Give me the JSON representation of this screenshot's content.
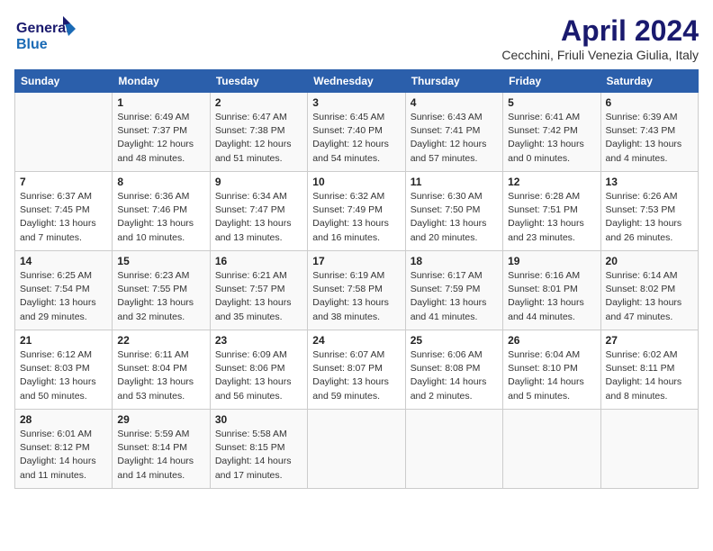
{
  "header": {
    "logo_line1": "General",
    "logo_line2": "Blue",
    "month_title": "April 2024",
    "location": "Cecchini, Friuli Venezia Giulia, Italy"
  },
  "columns": [
    "Sunday",
    "Monday",
    "Tuesday",
    "Wednesday",
    "Thursday",
    "Friday",
    "Saturday"
  ],
  "weeks": [
    [
      {
        "day": "",
        "info": ""
      },
      {
        "day": "1",
        "info": "Sunrise: 6:49 AM\nSunset: 7:37 PM\nDaylight: 12 hours\nand 48 minutes."
      },
      {
        "day": "2",
        "info": "Sunrise: 6:47 AM\nSunset: 7:38 PM\nDaylight: 12 hours\nand 51 minutes."
      },
      {
        "day": "3",
        "info": "Sunrise: 6:45 AM\nSunset: 7:40 PM\nDaylight: 12 hours\nand 54 minutes."
      },
      {
        "day": "4",
        "info": "Sunrise: 6:43 AM\nSunset: 7:41 PM\nDaylight: 12 hours\nand 57 minutes."
      },
      {
        "day": "5",
        "info": "Sunrise: 6:41 AM\nSunset: 7:42 PM\nDaylight: 13 hours\nand 0 minutes."
      },
      {
        "day": "6",
        "info": "Sunrise: 6:39 AM\nSunset: 7:43 PM\nDaylight: 13 hours\nand 4 minutes."
      }
    ],
    [
      {
        "day": "7",
        "info": "Sunrise: 6:37 AM\nSunset: 7:45 PM\nDaylight: 13 hours\nand 7 minutes."
      },
      {
        "day": "8",
        "info": "Sunrise: 6:36 AM\nSunset: 7:46 PM\nDaylight: 13 hours\nand 10 minutes."
      },
      {
        "day": "9",
        "info": "Sunrise: 6:34 AM\nSunset: 7:47 PM\nDaylight: 13 hours\nand 13 minutes."
      },
      {
        "day": "10",
        "info": "Sunrise: 6:32 AM\nSunset: 7:49 PM\nDaylight: 13 hours\nand 16 minutes."
      },
      {
        "day": "11",
        "info": "Sunrise: 6:30 AM\nSunset: 7:50 PM\nDaylight: 13 hours\nand 20 minutes."
      },
      {
        "day": "12",
        "info": "Sunrise: 6:28 AM\nSunset: 7:51 PM\nDaylight: 13 hours\nand 23 minutes."
      },
      {
        "day": "13",
        "info": "Sunrise: 6:26 AM\nSunset: 7:53 PM\nDaylight: 13 hours\nand 26 minutes."
      }
    ],
    [
      {
        "day": "14",
        "info": "Sunrise: 6:25 AM\nSunset: 7:54 PM\nDaylight: 13 hours\nand 29 minutes."
      },
      {
        "day": "15",
        "info": "Sunrise: 6:23 AM\nSunset: 7:55 PM\nDaylight: 13 hours\nand 32 minutes."
      },
      {
        "day": "16",
        "info": "Sunrise: 6:21 AM\nSunset: 7:57 PM\nDaylight: 13 hours\nand 35 minutes."
      },
      {
        "day": "17",
        "info": "Sunrise: 6:19 AM\nSunset: 7:58 PM\nDaylight: 13 hours\nand 38 minutes."
      },
      {
        "day": "18",
        "info": "Sunrise: 6:17 AM\nSunset: 7:59 PM\nDaylight: 13 hours\nand 41 minutes."
      },
      {
        "day": "19",
        "info": "Sunrise: 6:16 AM\nSunset: 8:01 PM\nDaylight: 13 hours\nand 44 minutes."
      },
      {
        "day": "20",
        "info": "Sunrise: 6:14 AM\nSunset: 8:02 PM\nDaylight: 13 hours\nand 47 minutes."
      }
    ],
    [
      {
        "day": "21",
        "info": "Sunrise: 6:12 AM\nSunset: 8:03 PM\nDaylight: 13 hours\nand 50 minutes."
      },
      {
        "day": "22",
        "info": "Sunrise: 6:11 AM\nSunset: 8:04 PM\nDaylight: 13 hours\nand 53 minutes."
      },
      {
        "day": "23",
        "info": "Sunrise: 6:09 AM\nSunset: 8:06 PM\nDaylight: 13 hours\nand 56 minutes."
      },
      {
        "day": "24",
        "info": "Sunrise: 6:07 AM\nSunset: 8:07 PM\nDaylight: 13 hours\nand 59 minutes."
      },
      {
        "day": "25",
        "info": "Sunrise: 6:06 AM\nSunset: 8:08 PM\nDaylight: 14 hours\nand 2 minutes."
      },
      {
        "day": "26",
        "info": "Sunrise: 6:04 AM\nSunset: 8:10 PM\nDaylight: 14 hours\nand 5 minutes."
      },
      {
        "day": "27",
        "info": "Sunrise: 6:02 AM\nSunset: 8:11 PM\nDaylight: 14 hours\nand 8 minutes."
      }
    ],
    [
      {
        "day": "28",
        "info": "Sunrise: 6:01 AM\nSunset: 8:12 PM\nDaylight: 14 hours\nand 11 minutes."
      },
      {
        "day": "29",
        "info": "Sunrise: 5:59 AM\nSunset: 8:14 PM\nDaylight: 14 hours\nand 14 minutes."
      },
      {
        "day": "30",
        "info": "Sunrise: 5:58 AM\nSunset: 8:15 PM\nDaylight: 14 hours\nand 17 minutes."
      },
      {
        "day": "",
        "info": ""
      },
      {
        "day": "",
        "info": ""
      },
      {
        "day": "",
        "info": ""
      },
      {
        "day": "",
        "info": ""
      }
    ]
  ]
}
